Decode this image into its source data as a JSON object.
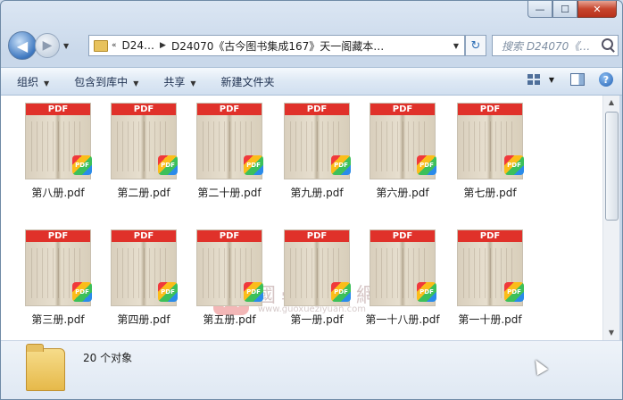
{
  "window": {
    "caption_buttons": [
      "—",
      "☐",
      "✕"
    ]
  },
  "nav": {
    "back": "◀",
    "forward": "▶"
  },
  "address": {
    "breadcrumb": [
      "D24…",
      "D24070《古今图书集成167》天一阁藏本…"
    ]
  },
  "search": {
    "placeholder": "搜索 D24070《…"
  },
  "toolbar": {
    "organize": "组织",
    "include_library": "包含到库中",
    "share": "共享",
    "new_folder": "新建文件夹"
  },
  "files": [
    {
      "name": "第八册.pdf"
    },
    {
      "name": "第二册.pdf"
    },
    {
      "name": "第二十册.pdf"
    },
    {
      "name": "第九册.pdf"
    },
    {
      "name": "第六册.pdf"
    },
    {
      "name": "第七册.pdf"
    },
    {
      "name": "第三册.pdf"
    },
    {
      "name": "第四册.pdf"
    },
    {
      "name": "第五册.pdf"
    },
    {
      "name": "第一册.pdf"
    },
    {
      "name": "第一十八册.pdf"
    },
    {
      "name": "第一十册.pdf"
    }
  ],
  "thumb_label": "PDF",
  "badge_label": "PDF",
  "watermark": {
    "seal": "國",
    "text": "國學資源網",
    "url": "www.guoxueziyuan.com"
  },
  "status": {
    "count": "20 个对象"
  }
}
